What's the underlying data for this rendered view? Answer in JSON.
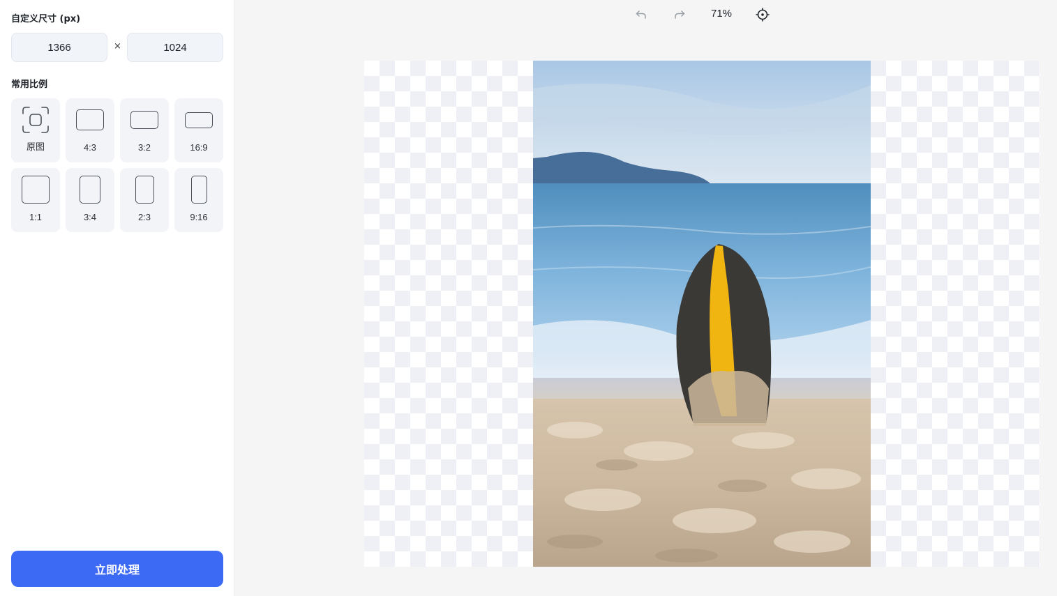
{
  "sidebar": {
    "custom_size_title": "自定义尺寸 (px)",
    "width_value": "1366",
    "height_value": "1024",
    "times_sign": "×",
    "ratios_title": "常用比例",
    "ratios": [
      {
        "label": "原图",
        "icon": "original-frame-icon"
      },
      {
        "label": "4:3",
        "icon": "ratio-4-3-icon"
      },
      {
        "label": "3:2",
        "icon": "ratio-3-2-icon"
      },
      {
        "label": "16:9",
        "icon": "ratio-16-9-icon"
      },
      {
        "label": "1:1",
        "icon": "ratio-1-1-icon"
      },
      {
        "label": "3:4",
        "icon": "ratio-3-4-icon"
      },
      {
        "label": "2:3",
        "icon": "ratio-2-3-icon"
      },
      {
        "label": "9:16",
        "icon": "ratio-9-16-icon"
      }
    ],
    "process_button": "立即处理"
  },
  "toolbar": {
    "undo_icon": "undo-icon",
    "redo_icon": "redo-icon",
    "zoom": "71%",
    "locate_icon": "crosshair-icon"
  },
  "colors": {
    "accent": "#3d6af5",
    "card_bg": "#f2f4f8",
    "canvas_bg": "#f5f5f6"
  }
}
